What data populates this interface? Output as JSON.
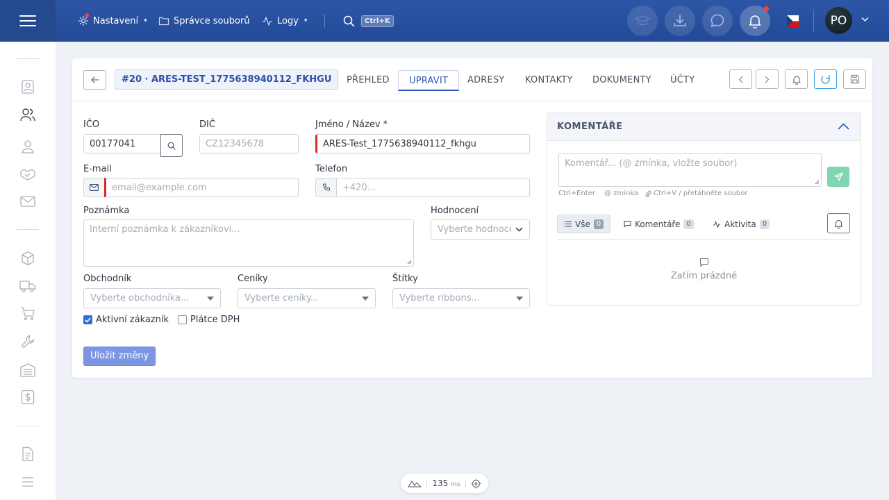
{
  "topbar": {
    "nav": [
      {
        "label": "Nastavení",
        "icon": "gear-icon",
        "has_caret": true
      },
      {
        "label": "Správce souborů",
        "icon": "folder-icon",
        "has_caret": false
      },
      {
        "label": "Logy",
        "icon": "activity-icon",
        "has_caret": true
      }
    ],
    "search_shortcut": "Ctrl+K",
    "avatar_initials": "PO",
    "notification_dot_color": "#ff3b3b"
  },
  "customer": {
    "badge": "#20 · ARES-TEST_1775638940112_FKHGU",
    "tabs": [
      "PŘEHLED",
      "UPRAVIT",
      "ADRESY",
      "KONTAKTY",
      "DOKUMENTY",
      "ÚČTY"
    ],
    "active_tab": "UPRAVIT"
  },
  "form": {
    "ico_label": "IČO",
    "ico_value": "00177041",
    "dic_label": "DIČ",
    "dic_placeholder": "CZ12345678",
    "name_label": "Jméno / Název *",
    "name_value": "ARES-Test_1775638940112_fkhgu",
    "email_label": "E-mail",
    "email_placeholder": "email@example.com",
    "phone_label": "Telefon",
    "phone_placeholder": "+420...",
    "note_label": "Poznámka",
    "note_placeholder": "Interní poznámka k zákazníkovi...",
    "rating_label": "Hodnocení",
    "rating_placeholder": "Vyberte hodnocení",
    "salesman_label": "Obchodník",
    "salesman_placeholder": "Vyberte obchodníka...",
    "pricelists_label": "Ceníky",
    "pricelists_placeholder": "Vyberte ceníky...",
    "tags_label": "Štítky",
    "tags_placeholder": "Vyberte ribbons...",
    "active_label": "Aktivní zákazník",
    "active_checked": true,
    "vat_label": "Plátce DPH",
    "vat_checked": false,
    "save_label": "Uložit změny"
  },
  "comments": {
    "title": "KOMENTÁŘE",
    "input_placeholder": "Komentář... (@ zmínka, vložte soubor)",
    "hint_send": "Ctrl+Enter",
    "hint_mention": "@ zmínka",
    "hint_attach": "Ctrl+V / přetáhněte soubor",
    "filters": [
      {
        "label": "Vše",
        "count": "0"
      },
      {
        "label": "Komentáře",
        "count": "0"
      },
      {
        "label": "Aktivita",
        "count": "0"
      }
    ],
    "empty_text": "Zatím prázdné"
  },
  "status": {
    "response_time": "135",
    "unit": "ms"
  },
  "colors": {
    "topbar": "#2a52a0",
    "accent": "#2c57b8",
    "required": "#d42a2a",
    "save_button": "#7d96e3",
    "send_button": "#7ed7b0"
  }
}
